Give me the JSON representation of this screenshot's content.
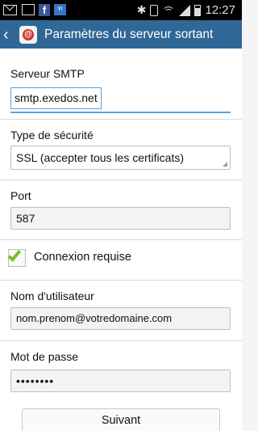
{
  "status_bar": {
    "left_icons": [
      "mail-icon",
      "image-icon",
      "facebook-icon",
      "yahoo-icon"
    ],
    "facebook_glyph": "f",
    "yahoo_glyph": "Y!",
    "time": "12:27"
  },
  "action_bar": {
    "title": "Paramètres du serveur sortant",
    "app_icon_glyph": "@",
    "accent": "#2f6796"
  },
  "form": {
    "smtp": {
      "label": "Serveur SMTP",
      "value": "smtp.exedos.net"
    },
    "security": {
      "label": "Type de sécurité",
      "selected": "SSL (accepter tous les certificats)"
    },
    "port": {
      "label": "Port",
      "value": "587"
    },
    "auth": {
      "label": "Connexion requise",
      "checked": true
    },
    "username": {
      "label": "Nom d'utilisateur",
      "value": "nom.prenom@votredomaine.com"
    },
    "password": {
      "label": "Mot de passe",
      "value": "••••••••"
    }
  },
  "next_button": {
    "label": "Suivant"
  },
  "colors": {
    "focus": "#5aa0d8",
    "check": "#7fbc2f"
  }
}
